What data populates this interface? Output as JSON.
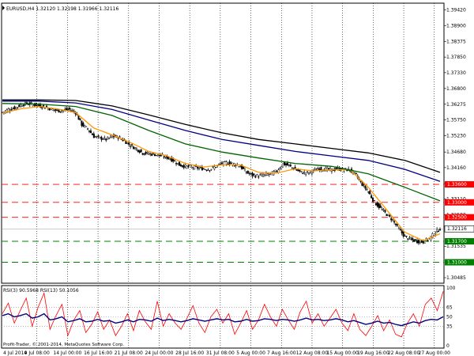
{
  "chart_header": {
    "symbol_info": "EURUSD,H4  1.32120 1.32198 1.31966 1.32116"
  },
  "indicator_header": {
    "text": "RSI(3) 90.5968  RSI(13) 50.1056"
  },
  "copyright": "Profit-Trader, © 2001-2014, MetaQuotes Software Corp.",
  "colors": {
    "background": "#ffffff",
    "grid": "#000000",
    "bull_candle": "#000000",
    "bear_candle": "#000000",
    "ema_fast": "#ff9900",
    "ma_green": "#006400",
    "ma_navy": "#000080",
    "ma_black": "#000000",
    "resistance_line": "#ff0000",
    "support_line": "#008000",
    "rsi_fast": "#ff0000",
    "rsi_slow": "#000080",
    "current_price_tag": "#000000"
  },
  "chart_data": [
    {
      "type": "candlestick",
      "symbol": "EURUSD",
      "timeframe": "H4",
      "ohlc_last": {
        "open": 1.3212,
        "high": 1.32198,
        "low": 1.31966,
        "close": 1.32116
      },
      "x_tick_labels": [
        "4 Jul 2014",
        "9 Jul 08:00",
        "14 Jul 00:00",
        "16 Jul 16:00",
        "21 Jul 08:00",
        "24 Jul 00:00",
        "28 Jul 16:00",
        "31 Jul 08:00",
        "5 Aug 00:00",
        "7 Aug 16:00",
        "12 Aug 08:00",
        "15 Aug 00:00",
        "19 Aug 16:00",
        "22 Aug 08:00",
        "27 Aug 00:00"
      ],
      "y_tick_labels": [
        "1.39420",
        "1.38900",
        "1.38375",
        "1.37850",
        "1.37330",
        "1.36800",
        "1.36275",
        "1.35750",
        "1.35230",
        "1.34680",
        "1.34160",
        "1.33630",
        "1.33110",
        "1.32580",
        "1.31535",
        "1.30485"
      ],
      "ylim": [
        1.303,
        1.3965
      ],
      "close_points": [
        [
          0,
          1.36
        ],
        [
          4,
          1.361
        ],
        [
          8,
          1.3615
        ],
        [
          12,
          1.3625
        ],
        [
          16,
          1.363
        ],
        [
          20,
          1.3628
        ],
        [
          24,
          1.3622
        ],
        [
          28,
          1.3618
        ],
        [
          32,
          1.3612
        ],
        [
          36,
          1.3605
        ],
        [
          40,
          1.3608
        ],
        [
          44,
          1.361
        ],
        [
          48,
          1.36
        ],
        [
          52,
          1.356
        ],
        [
          56,
          1.3545
        ],
        [
          60,
          1.352
        ],
        [
          64,
          1.3515
        ],
        [
          68,
          1.351
        ],
        [
          72,
          1.352
        ],
        [
          76,
          1.3518
        ],
        [
          80,
          1.3505
        ],
        [
          84,
          1.349
        ],
        [
          88,
          1.3478
        ],
        [
          92,
          1.3465
        ],
        [
          96,
          1.3462
        ],
        [
          100,
          1.346
        ],
        [
          104,
          1.3455
        ],
        [
          108,
          1.345
        ],
        [
          112,
          1.344
        ],
        [
          116,
          1.3425
        ],
        [
          120,
          1.342
        ],
        [
          124,
          1.3418
        ],
        [
          128,
          1.3415
        ],
        [
          132,
          1.3412
        ],
        [
          136,
          1.341
        ],
        [
          140,
          1.342
        ],
        [
          144,
          1.343
        ],
        [
          148,
          1.3432
        ],
        [
          152,
          1.3428
        ],
        [
          156,
          1.342
        ],
        [
          160,
          1.34
        ],
        [
          164,
          1.339
        ],
        [
          168,
          1.3388
        ],
        [
          172,
          1.3392
        ],
        [
          176,
          1.3395
        ],
        [
          180,
          1.3405
        ],
        [
          184,
          1.3428
        ],
        [
          188,
          1.3422
        ],
        [
          192,
          1.341
        ],
        [
          196,
          1.34
        ],
        [
          200,
          1.3398
        ],
        [
          204,
          1.3405
        ],
        [
          208,
          1.3412
        ],
        [
          212,
          1.341
        ],
        [
          216,
          1.3408
        ],
        [
          220,
          1.3412
        ],
        [
          224,
          1.341
        ],
        [
          228,
          1.3408
        ],
        [
          232,
          1.339
        ],
        [
          236,
          1.336
        ],
        [
          240,
          1.3335
        ],
        [
          244,
          1.33
        ],
        [
          248,
          1.328
        ],
        [
          252,
          1.326
        ],
        [
          256,
          1.324
        ],
        [
          260,
          1.321
        ],
        [
          264,
          1.3185
        ],
        [
          268,
          1.3175
        ],
        [
          272,
          1.317
        ],
        [
          276,
          1.3168
        ],
        [
          280,
          1.318
        ],
        [
          284,
          1.32
        ],
        [
          287,
          1.32116
        ]
      ],
      "moving_averages": [
        {
          "color": "#ff9900",
          "points": [
            [
              0,
              1.3598
            ],
            [
              12,
              1.3612
            ],
            [
              24,
              1.362
            ],
            [
              36,
              1.3612
            ],
            [
              48,
              1.36
            ],
            [
              60,
              1.3548
            ],
            [
              72,
              1.3525
            ],
            [
              84,
              1.35
            ],
            [
              96,
              1.347
            ],
            [
              108,
              1.3455
            ],
            [
              120,
              1.343
            ],
            [
              132,
              1.3418
            ],
            [
              144,
              1.3425
            ],
            [
              156,
              1.3425
            ],
            [
              168,
              1.34
            ],
            [
              180,
              1.3398
            ],
            [
              192,
              1.3412
            ],
            [
              204,
              1.3405
            ],
            [
              216,
              1.3409
            ],
            [
              228,
              1.3409
            ],
            [
              240,
              1.335
            ],
            [
              252,
              1.3275
            ],
            [
              264,
              1.32
            ],
            [
              276,
              1.3172
            ],
            [
              287,
              1.3195
            ]
          ]
        },
        {
          "color": "#006400",
          "points": [
            [
              0,
              1.363
            ],
            [
              24,
              1.3628
            ],
            [
              48,
              1.362
            ],
            [
              72,
              1.359
            ],
            [
              96,
              1.354
            ],
            [
              120,
              1.3495
            ],
            [
              144,
              1.3468
            ],
            [
              168,
              1.3448
            ],
            [
              192,
              1.343
            ],
            [
              216,
              1.342
            ],
            [
              240,
              1.3395
            ],
            [
              264,
              1.335
            ],
            [
              287,
              1.3305
            ]
          ]
        },
        {
          "color": "#000080",
          "points": [
            [
              0,
              1.3638
            ],
            [
              24,
              1.3638
            ],
            [
              48,
              1.3632
            ],
            [
              72,
              1.361
            ],
            [
              96,
              1.3575
            ],
            [
              120,
              1.354
            ],
            [
              144,
              1.351
            ],
            [
              168,
              1.349
            ],
            [
              192,
              1.347
            ],
            [
              216,
              1.3455
            ],
            [
              240,
              1.344
            ],
            [
              264,
              1.341
            ],
            [
              287,
              1.337
            ]
          ]
        },
        {
          "color": "#000000",
          "points": [
            [
              0,
              1.3642
            ],
            [
              24,
              1.3642
            ],
            [
              48,
              1.364
            ],
            [
              72,
              1.3622
            ],
            [
              96,
              1.3592
            ],
            [
              120,
              1.356
            ],
            [
              144,
              1.3532
            ],
            [
              168,
              1.351
            ],
            [
              192,
              1.3495
            ],
            [
              216,
              1.348
            ],
            [
              240,
              1.3465
            ],
            [
              264,
              1.344
            ],
            [
              287,
              1.34
            ]
          ]
        }
      ],
      "horizontal_levels": [
        {
          "price": 1.336,
          "label": "1.33600",
          "color": "#ff0000",
          "style": "dashed"
        },
        {
          "price": 1.33,
          "label": "1.33000",
          "color": "#ff0000",
          "style": "dashed"
        },
        {
          "price": 1.325,
          "label": "1.32500",
          "color": "#ff0000",
          "style": "dashed"
        },
        {
          "price": 1.317,
          "label": "1.31700",
          "color": "#008000",
          "style": "dashed"
        },
        {
          "price": 1.31,
          "label": "1.31000",
          "color": "#008000",
          "style": "dashed"
        }
      ],
      "current_price": {
        "price": 1.32116,
        "label": "1.32116"
      },
      "grid": true
    },
    {
      "type": "line",
      "indicator": "RSI",
      "y_tick_labels": [
        "100",
        "65",
        "50",
        "35",
        "0"
      ],
      "ylim": [
        0,
        100
      ],
      "levels": [
        65,
        50,
        35
      ],
      "series": [
        {
          "name": "RSI(3)",
          "color": "#ff0000",
          "values": [
            55,
            72,
            40,
            60,
            80,
            35,
            65,
            88,
            30,
            52,
            70,
            20,
            45,
            60,
            25,
            38,
            58,
            30,
            45,
            20,
            35,
            55,
            28,
            60,
            42,
            30,
            75,
            35,
            55,
            40,
            30,
            48,
            68,
            40,
            25,
            50,
            62,
            40,
            55,
            22,
            40,
            60,
            30,
            45,
            70,
            50,
            35,
            62,
            45,
            30,
            58,
            75,
            40,
            55,
            35,
            48,
            62,
            40,
            28,
            55,
            30,
            20,
            35,
            52,
            28,
            45,
            22,
            18,
            40,
            55,
            35,
            70,
            80,
            60,
            90.6
          ]
        },
        {
          "name": "RSI(13)",
          "color": "#000080",
          "values": [
            52,
            55,
            50,
            52,
            55,
            48,
            50,
            55,
            45,
            47,
            50,
            42,
            44,
            47,
            42,
            43,
            46,
            43,
            44,
            40,
            42,
            45,
            42,
            46,
            45,
            43,
            48,
            44,
            46,
            44,
            42,
            44,
            47,
            45,
            43,
            45,
            47,
            45,
            46,
            42,
            43,
            46,
            43,
            44,
            47,
            46,
            44,
            46,
            45,
            43,
            45,
            48,
            45,
            46,
            44,
            45,
            47,
            45,
            42,
            44,
            41,
            38,
            40,
            43,
            40,
            41,
            38,
            36,
            39,
            42,
            40,
            44,
            46,
            45,
            50.1
          ]
        }
      ],
      "grid": true
    }
  ]
}
